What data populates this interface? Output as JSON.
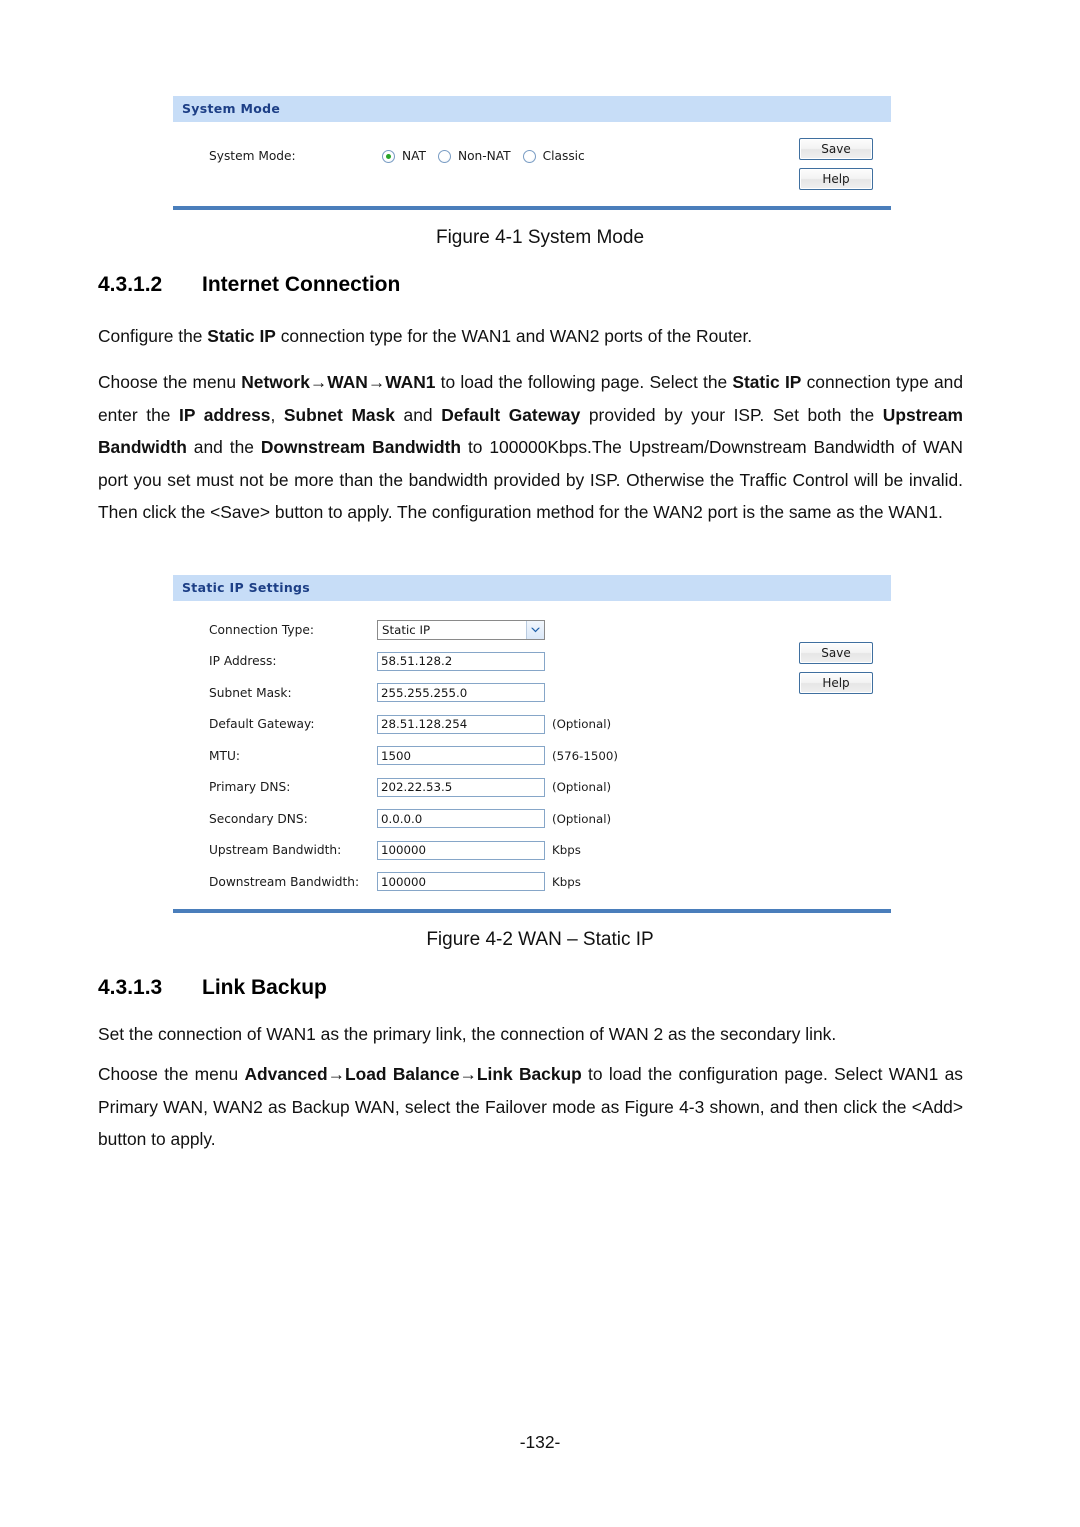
{
  "document": {
    "page_number": "-132-"
  },
  "figure1": {
    "panel_title": "System Mode",
    "row_label": "System Mode:",
    "options": [
      {
        "label": "NAT",
        "selected": true
      },
      {
        "label": "Non-NAT",
        "selected": false
      },
      {
        "label": "Classic",
        "selected": false
      }
    ],
    "buttons": {
      "save": "Save",
      "help": "Help"
    },
    "caption": "Figure 4-1 System Mode"
  },
  "section_internet": {
    "number": "4.3.1.2",
    "title": "Internet Connection",
    "para1_prefix": "Configure the ",
    "para1_bold": "Static IP",
    "para1_suffix": " connection type for the WAN1 and WAN2 ports of the Router.",
    "para2": {
      "t1": "Choose the menu ",
      "b1": "Network→WAN→WAN1",
      "t2": " to load the following page. Select the ",
      "b2": "Static IP",
      "t3": " connection type and enter the ",
      "b3": "IP address",
      "t4": ", ",
      "b4": "Subnet Mask",
      "t5": " and ",
      "b5": "Default Gateway",
      "t6": " provided by your ISP. Set both the ",
      "b6": "Upstream Bandwidth",
      "t7": " and the ",
      "b7": "Downstream Bandwidth",
      "t8": " to 100000Kbps.The Upstream/Downstream Bandwidth of WAN port you set must not be more than the bandwidth provided by ISP. Otherwise the Traffic Control will be invalid. Then click the <Save> button to apply. The configuration method for the WAN2 port is the same as the WAN1."
    }
  },
  "figure2": {
    "panel_title": "Static IP Settings",
    "fields": [
      {
        "label": "Connection Type:",
        "type": "select",
        "value": "Static IP",
        "hint": ""
      },
      {
        "label": "IP Address:",
        "type": "text",
        "value": "58.51.128.2",
        "hint": ""
      },
      {
        "label": "Subnet Mask:",
        "type": "text",
        "value": "255.255.255.0",
        "hint": ""
      },
      {
        "label": "Default Gateway:",
        "type": "text",
        "value": "28.51.128.254",
        "hint": "(Optional)"
      },
      {
        "label": "MTU:",
        "type": "text",
        "value": "1500",
        "hint": "(576-1500)"
      },
      {
        "label": "Primary DNS:",
        "type": "text",
        "value": "202.22.53.5",
        "hint": "(Optional)"
      },
      {
        "label": "Secondary DNS:",
        "type": "text",
        "value": "0.0.0.0",
        "hint": "(Optional)"
      },
      {
        "label": "Upstream Bandwidth:",
        "type": "text",
        "value": "100000",
        "hint": "Kbps"
      },
      {
        "label": "Downstream Bandwidth:",
        "type": "text",
        "value": "100000",
        "hint": "Kbps"
      }
    ],
    "buttons": {
      "save": "Save",
      "help": "Help"
    },
    "caption": "Figure 4-2 WAN – Static IP"
  },
  "section_linkbackup": {
    "number": "4.3.1.3",
    "title": "Link Backup",
    "para1": "Set the connection of WAN1 as the primary link, the connection of WAN 2 as the secondary link.",
    "para2": {
      "t1": "Choose the menu ",
      "b1": "Advanced→Load Balance→Link Backup",
      "t2": " to load the configuration page. Select WAN1 as Primary WAN, WAN2 as Backup WAN, select the Failover mode as Figure 4-3 shown, and then click the <Add> button to apply."
    }
  },
  "colors": {
    "panel_header_bg": "#c7ddf7",
    "panel_header_text": "#1d3f86",
    "panel_bottom_border": "#4a7ebb",
    "radio_selected": "#28a428",
    "input_border": "#86a6c8",
    "button_border": "#3f6f9f"
  }
}
